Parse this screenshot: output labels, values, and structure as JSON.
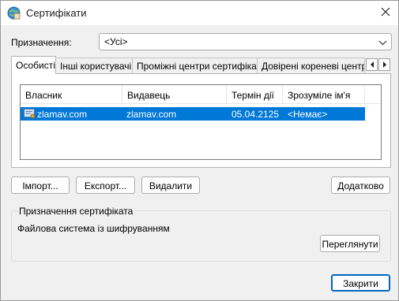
{
  "window": {
    "title": "Сертифікати",
    "icons": {
      "app": "certificate-app-icon",
      "close": "close-icon"
    }
  },
  "purpose": {
    "label": "Призначення:",
    "selected": "<Усі>"
  },
  "tabs": [
    {
      "label": "Особисті",
      "active": true
    },
    {
      "label": "Інші користувачі",
      "active": false
    },
    {
      "label": "Проміжні центри сертифікації",
      "active": false
    },
    {
      "label": "Довірені кореневі центри",
      "active": false
    }
  ],
  "list": {
    "columns": [
      "Власник",
      "Видавець",
      "Термін дії",
      "Зрозуміле ім'я"
    ],
    "rows": [
      {
        "owner": "zlamav.com",
        "issuer": "zlamav.com",
        "expires": "05.04.2125",
        "friendly": "<Немає>",
        "selected": true
      }
    ]
  },
  "buttons": {
    "import": "Імпорт...",
    "export": "Експорт...",
    "delete": "Видалити",
    "advanced": "Додатково",
    "view": "Переглянути",
    "close": "Закрити"
  },
  "group": {
    "title": "Призначення сертифіката",
    "text": "Файлова система із шифруванням"
  },
  "colors": {
    "selection": "#0078d7",
    "accent": "#0067c0"
  }
}
